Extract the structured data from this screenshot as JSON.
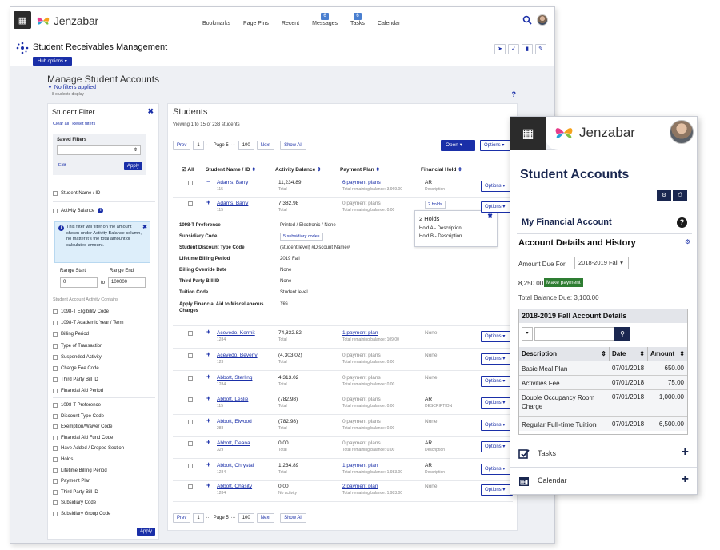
{
  "app": {
    "name": "Jenzabar"
  },
  "nav": [
    {
      "label": "Bookmarks",
      "badge": ""
    },
    {
      "label": "Page Pins",
      "badge": ""
    },
    {
      "label": "Recent",
      "badge": ""
    },
    {
      "label": "Messages",
      "badge": "6"
    },
    {
      "label": "Tasks",
      "badge": "6"
    },
    {
      "label": "Calendar",
      "badge": ""
    }
  ],
  "hub": {
    "title": "Student Receivables Management",
    "options_label": "Hub options"
  },
  "page": {
    "title": "Manage Student Accounts",
    "filters_link": "No filters applied",
    "students_display": "8 students display",
    "help": "?"
  },
  "filter": {
    "title": "Student Filter",
    "clear_all": "Clear all",
    "reset": "Reset filters",
    "saved_label": "Saved Filters",
    "edit": "Edit",
    "apply": "Apply",
    "student_name": "Student Name / ID",
    "activity_balance": "Activity Balance",
    "info_text": "This filter will filter on the amount shown under Activity Balance column, no matter it's the total amount or calculated amount.",
    "range_start_label": "Range Start",
    "range_end_label": "Range End",
    "range_start": "0",
    "range_to": "to",
    "range_end": "100000",
    "section_label": "Student Account Activity Contains",
    "activity_items": [
      "1098-T Eligibility Code",
      "1098-T Academic Year / Term",
      "Billing Period",
      "Type of Transaction",
      "Suspended Activity",
      "Charge Fee Code",
      "Third Party Bill ID",
      "Financial Aid Period"
    ],
    "other_items": [
      "1098-T Preference",
      "Discount Type Code",
      "Exemption/Waiver Code",
      "Financial Aid Fund Code",
      "Have Added / Droped Section",
      "Holds",
      "Lifetime Billing Period",
      "Payment Plan",
      "Third Party Bill ID",
      "Subsidiary Code",
      "Subsidiary Group Code"
    ],
    "apply_bottom": "Apply"
  },
  "students": {
    "title": "Students",
    "viewing": "Viewing 1 to 15 of 233 students",
    "pager": {
      "prev": "Prev",
      "page_num": "1",
      "ellipsis": "···",
      "page_label": "Page 5",
      "last": "100",
      "next": "Next",
      "show_all": "Show All"
    },
    "open_label": "Open",
    "options_label": "Options",
    "headers": {
      "all": "All",
      "name": "Student Name / ID",
      "balance": "Activity Balance",
      "plan": "Payment Plan",
      "hold": "Financial Hold"
    },
    "rows": [
      {
        "toggle": "−",
        "name": "Adams, Barry",
        "id": "115",
        "balance": "11,234.89",
        "balance_sub": "Total",
        "plan": "6 payment plans",
        "plan_linked": true,
        "plan_sub": "Total remaining balance: 3,969.00",
        "hold": "AR",
        "hold_sub": "Description"
      },
      {
        "toggle": "+",
        "name": "Adams, Barry",
        "id": "115",
        "balance": "7,382.98",
        "balance_sub": "Total",
        "plan": "0 payment plans",
        "plan_linked": false,
        "plan_sub": "Total remaining balance: 0.00",
        "hold": "2 holds",
        "hold_sub": ""
      },
      {
        "toggle": "+",
        "name": "Acevedo, Kermit",
        "id": "1284",
        "balance": "74,832.82",
        "balance_sub": "Total",
        "plan": "1 payment plan",
        "plan_linked": true,
        "plan_sub": "Total remaining balance: 109.00",
        "hold": "None",
        "hold_sub": ""
      },
      {
        "toggle": "+",
        "name": "Acevedo, Beverly",
        "id": "123",
        "balance": "(4,303.02)",
        "balance_sub": "Total",
        "plan": "0 payment plans",
        "plan_linked": false,
        "plan_sub": "Total remaining balance: 0.00",
        "hold": "None",
        "hold_sub": ""
      },
      {
        "toggle": "+",
        "name": "Abbott, Sterling",
        "id": "1284",
        "balance": "4,313.02",
        "balance_sub": "Total",
        "plan": "0 payment plans",
        "plan_linked": false,
        "plan_sub": "Total remaining balance: 0.00",
        "hold": "None",
        "hold_sub": ""
      },
      {
        "toggle": "+",
        "name": "Abbott, Leslie",
        "id": "115",
        "balance": "(782.98)",
        "balance_sub": "Total",
        "plan": "0 payment plans",
        "plan_linked": false,
        "plan_sub": "Total remaining balance: 0.00",
        "hold": "AR",
        "hold_sub": "DESCRIPTION"
      },
      {
        "toggle": "+",
        "name": "Abbott, Elwood",
        "id": "288",
        "balance": "(782.98)",
        "balance_sub": "Total",
        "plan": "0 payment plans",
        "plan_linked": false,
        "plan_sub": "Total remaining balance: 0.00",
        "hold": "None",
        "hold_sub": ""
      },
      {
        "toggle": "+",
        "name": "Abbott, Deana",
        "id": "329",
        "balance": "0.00",
        "balance_sub": "Total",
        "plan": "0 payment plans",
        "plan_linked": false,
        "plan_sub": "Total remaining balance: 0.00",
        "hold": "AR",
        "hold_sub": "Description"
      },
      {
        "toggle": "+",
        "name": "Abbott, Chrystal",
        "id": "1284",
        "balance": "1,234.89",
        "balance_sub": "Total",
        "plan": "1 payment plan",
        "plan_linked": true,
        "plan_sub": "Total remaining balance: 1,983.00",
        "hold": "AR",
        "hold_sub": "Description"
      },
      {
        "toggle": "+",
        "name": "Abbott, Chasity",
        "id": "1284",
        "balance": "0.00",
        "balance_sub": "No activity",
        "plan": "2 payment plan",
        "plan_linked": true,
        "plan_sub": "Total remaining balance: 1,983.00",
        "hold": "None",
        "hold_sub": ""
      }
    ],
    "details": [
      {
        "label": "1098-T Preference",
        "value": "Printed / Electronic / None"
      },
      {
        "label": "Subsidiary Code",
        "value": "5 subsidiary codes"
      },
      {
        "label": "Student Discount Type Code",
        "value": "(student level) #Discount Name#"
      },
      {
        "label": "Lifetime Billing Period",
        "value": "2019 Fall"
      },
      {
        "label": "Billing Override Date",
        "value": "None"
      },
      {
        "label": "Third Party Bill ID",
        "value": "None"
      },
      {
        "label": "Tuition Code",
        "value": "Student level"
      },
      {
        "label": "Apply Financial Aid to Miscellaneous Charges",
        "value": "Yes"
      }
    ],
    "holds_popup": {
      "title": "2 Holds",
      "items": [
        "Hold A - Description",
        "Hold B - Description"
      ]
    }
  },
  "mobile": {
    "app_name": "Jenzabar",
    "title": "Student Accounts",
    "section": "My Financial Account",
    "subsection": "Account Details and History",
    "amount_due_label": "Amount Due For",
    "amount_due_term": "2018-2019 Fall",
    "amount": "8,250.00",
    "pay_label": "Make payment",
    "total_balance": "Total Balance Due: 3,100.00",
    "table_title": "2018-2019 Fall Account Details",
    "columns": [
      "Description",
      "Date",
      "Amount"
    ],
    "rows": [
      {
        "desc": "Basic Meal Plan",
        "date": "07/01/2018",
        "amount": "650.00"
      },
      {
        "desc": "Activities Fee",
        "date": "07/01/2018",
        "amount": "75.00"
      },
      {
        "desc": "Double Occupancy Room Charge",
        "date": "07/01/2018",
        "amount": "1,000.00"
      },
      {
        "desc": "Regular Full-time Tuition",
        "date": "07/01/2018",
        "amount": "6,500.00"
      }
    ],
    "tasks": "Tasks",
    "calendar": "Calendar"
  },
  "colors": {
    "primary": "#1a2fa8",
    "mobile_navy": "#1a2750",
    "pay_green": "#2e7d32",
    "info_bg": "#ddeefa"
  }
}
